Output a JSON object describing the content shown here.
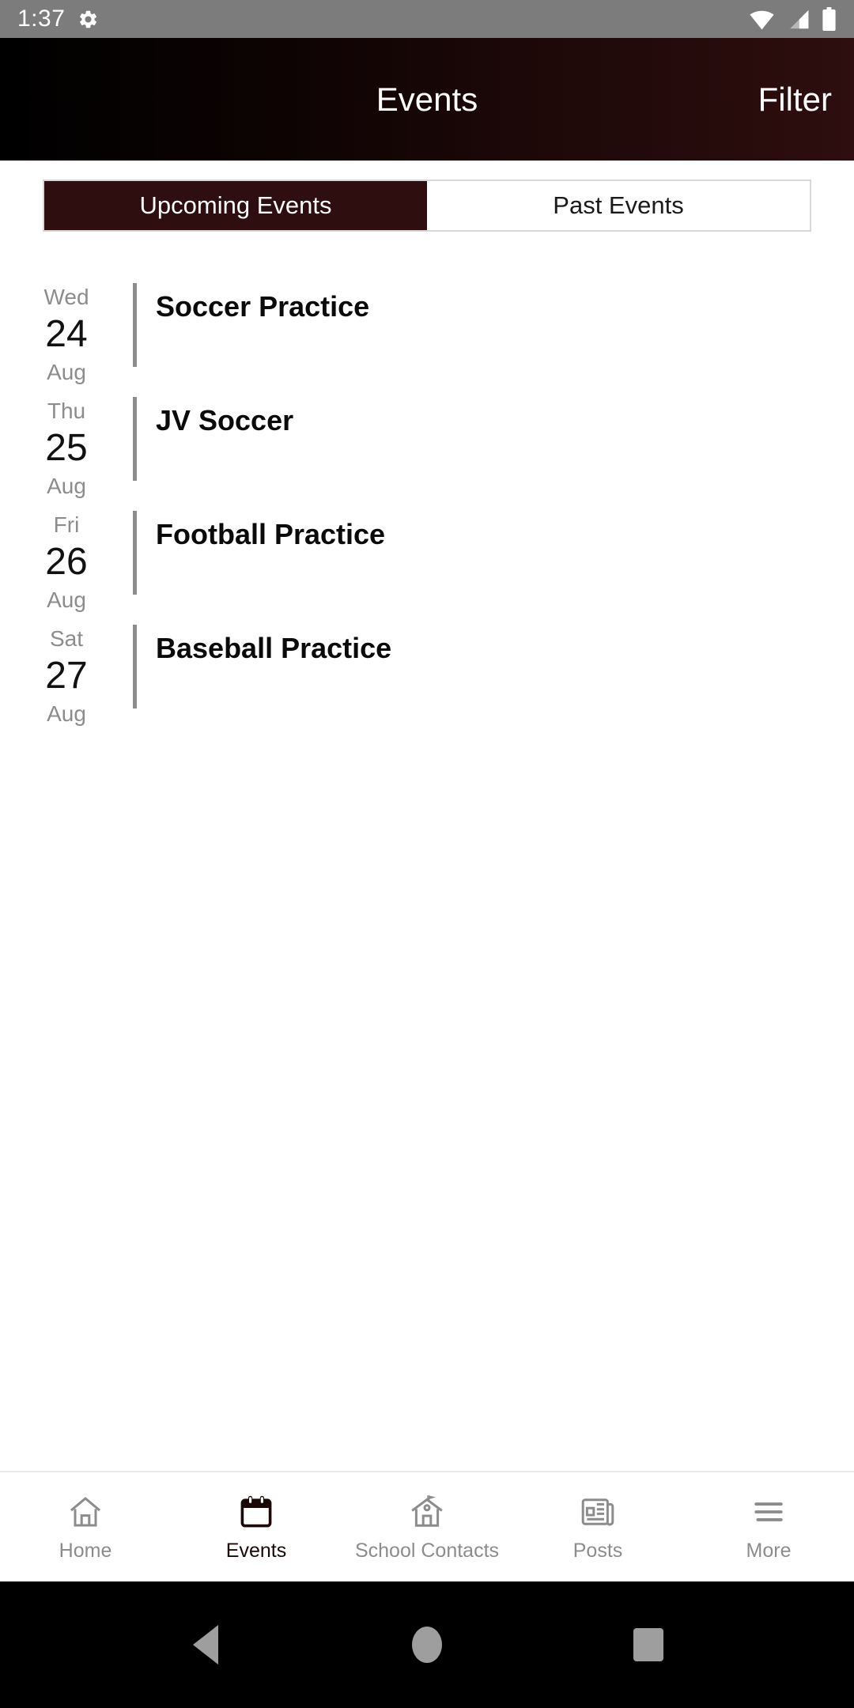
{
  "status_bar": {
    "time": "1:37",
    "icons": [
      "gear-icon",
      "wifi-icon",
      "cellular-signal-icon",
      "battery-icon"
    ],
    "background_color": "#7c7c7c"
  },
  "app_bar": {
    "title": "Events",
    "action_label": "Filter",
    "gradient_from": "#000000",
    "gradient_to": "#2e0e0e"
  },
  "tabs": {
    "items": [
      {
        "label": "Upcoming Events",
        "active": true
      },
      {
        "label": "Past Events",
        "active": false
      }
    ],
    "active_background": "#2e0e0e",
    "active_text_color": "#ffffff"
  },
  "events": [
    {
      "dow": "Wed",
      "day": "24",
      "month": "Aug",
      "title": "Soccer Practice"
    },
    {
      "dow": "Thu",
      "day": "25",
      "month": "Aug",
      "title": "JV Soccer"
    },
    {
      "dow": "Fri",
      "day": "26",
      "month": "Aug",
      "title": "Football Practice"
    },
    {
      "dow": "Sat",
      "day": "27",
      "month": "Aug",
      "title": "Baseball Practice"
    }
  ],
  "bottom_nav": {
    "items": [
      {
        "label": "Home",
        "icon": "house-icon",
        "active": false
      },
      {
        "label": "Events",
        "icon": "calendar-icon",
        "active": true
      },
      {
        "label": "School Contacts",
        "icon": "schoolhouse-icon",
        "active": false
      },
      {
        "label": "Posts",
        "icon": "newspaper-icon",
        "active": false
      },
      {
        "label": "More",
        "icon": "hamburger-icon",
        "active": false
      }
    ],
    "inactive_color": "#8c8c8c",
    "active_color": "#1b0707"
  },
  "system_nav": {
    "buttons": [
      "back-triangle-icon",
      "home-circle-icon",
      "recents-square-icon"
    ],
    "background_color": "#000000",
    "icon_color": "#9e9e9e"
  }
}
